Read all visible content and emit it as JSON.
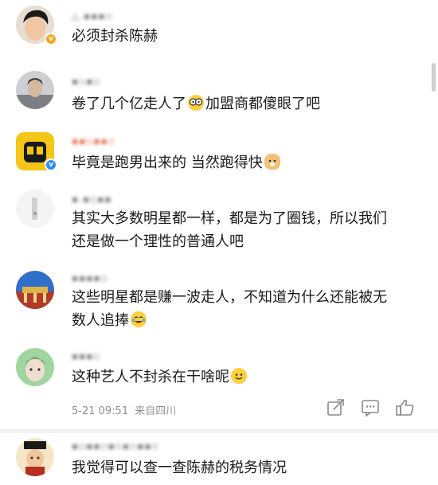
{
  "comments": [
    {
      "username": "△.▪▪▪▫",
      "text": "必须封杀陈赫"
    },
    {
      "username": "▪▫▪▫",
      "text": "卷了几个亿走人了",
      "text_after": "加盟商都傻眼了吧",
      "emoji": "glasses-face-emoji"
    },
    {
      "username": "▪▪▫▪▪▫",
      "text": "毕竟是跑男出来的 当然跑得快",
      "emoji": "doge-emoji"
    },
    {
      "username": "▪.▪▫▪▪",
      "text": "其实大多数明星都一样，都是为了圈钱，所以我们\n还是做一个理性的普通人吧"
    },
    {
      "username": "▪▪▪▪▫",
      "text": "这些明星都是赚一波走人，不知道为什么还能被无\n数人追捧",
      "emoji": "laugh-cry-emoji"
    },
    {
      "username": "▪▪▪▫",
      "text": "这种艺人不封杀在干啥呢",
      "emoji": "smile-emoji"
    },
    {
      "username": "▪▫▪▪▫▪▫▪▫▪▪▫",
      "text": "我觉得可以查一查陈赫的税务情况"
    }
  ],
  "footer": {
    "datetime": "5-21 09:51",
    "location": "来自四川"
  }
}
